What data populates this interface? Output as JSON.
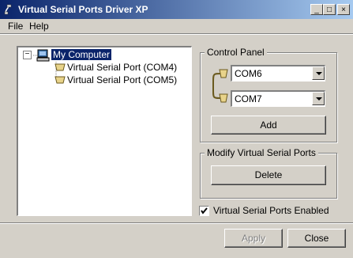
{
  "window": {
    "title": "Virtual Serial Ports Driver XP"
  },
  "titlebar_buttons": {
    "minimize": "_",
    "maximize": "□",
    "close": "×"
  },
  "menu": {
    "file": "File",
    "help": "Help"
  },
  "tree": {
    "root": {
      "label": "My Computer",
      "expander": "−"
    },
    "children": [
      {
        "label": "Virtual Serial Port (COM4)"
      },
      {
        "label": "Virtual Serial Port (COM5)"
      }
    ]
  },
  "control_panel": {
    "title": "Control Panel",
    "port1": "COM6",
    "port2": "COM7",
    "add_label": "Add"
  },
  "modify_panel": {
    "title": "Modify Virtual Serial Ports",
    "delete_label": "Delete"
  },
  "enabled_checkbox": {
    "label": "Virtual Serial Ports Enabled",
    "checked": true
  },
  "footer": {
    "apply_label": "Apply",
    "close_label": "Close"
  },
  "icons": {
    "app": "serial-plug-icon",
    "computer": "computer-icon",
    "port": "serial-port-icon"
  },
  "colors": {
    "titlebar": "#0a246a",
    "selection": "#0a246a",
    "face": "#d4d0c8"
  }
}
